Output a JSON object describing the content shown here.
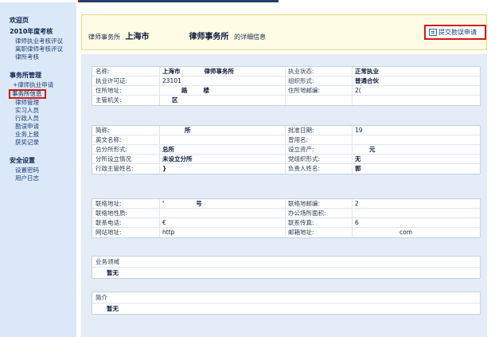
{
  "sidebar": {
    "welcome": "欢迎页",
    "sections": [
      {
        "heading": "2010年度考核",
        "items": [
          "律师执业考核评议",
          "离职律师考核评议",
          "律所考核"
        ]
      },
      {
        "heading": "事务所管理",
        "items": [
          "+律师执业申请",
          "事务所信息",
          "律师管理",
          "实习人员",
          "行政人员",
          "勘误申请",
          "业务上报",
          "获奖记录"
        ],
        "active": "事务所信息"
      },
      {
        "heading": "安全设置",
        "items": [
          "设置密码",
          "用户日志"
        ]
      }
    ]
  },
  "notice": {
    "prefix": "律师事务所",
    "city": "上海市",
    "firm": "律师事务所",
    "suffix": "的详细信息",
    "submit_button": "提交勘误申请"
  },
  "basic": [
    {
      "l1": "名称:",
      "v1": "上海市",
      "v1b": "律师事务所",
      "l2": "执业状态:",
      "v2": "正常执业"
    },
    {
      "l1": "执业许可证:",
      "v1": "23101",
      "l2": "组织形式:",
      "v2": "普通合伙"
    },
    {
      "l1": "住所地址:",
      "v1": "路",
      "v1b": "楼",
      "l2": "住所地邮编:",
      "v2": "2("
    },
    {
      "l1": "主管机关:",
      "v1": "区",
      "l2": "",
      "v2": ""
    }
  ],
  "details": [
    {
      "l1": "简称:",
      "v1": "所",
      "l2": "批准日期:",
      "v2": "19"
    },
    {
      "l1": "英文名称:",
      "v1": "",
      "l2": "曾用名:",
      "v2": ""
    },
    {
      "l1": "总分所形式:",
      "v1": "总所",
      "l2": "设立资产:",
      "v2": "元"
    },
    {
      "l1": "分所设立情况",
      "v1": "未设立分所",
      "l2": "党组织形式:",
      "v2": "无"
    },
    {
      "l1": "行政主管姓名:",
      "v1": "}",
      "l2": "负责人姓名:",
      "v2": "郭"
    }
  ],
  "contact": [
    {
      "l1": "联络地址:",
      "v1": "'",
      "v1b": "号",
      "l2": "联络地邮编:",
      "v2": "2"
    },
    {
      "l1": "联络地性质:",
      "v1": "",
      "l2": "办公场所面积:",
      "v2": ""
    },
    {
      "l1": "联系电话:",
      "v1": "€",
      "l2": "联系传真:",
      "v2": "6"
    },
    {
      "l1": "网站地址:",
      "v1": "http",
      "l2": "邮箱地址:",
      "v2": "com"
    }
  ],
  "business": {
    "title": "业务领域",
    "value": "暂无"
  },
  "intro": {
    "title": "简介",
    "value": "暂无"
  }
}
